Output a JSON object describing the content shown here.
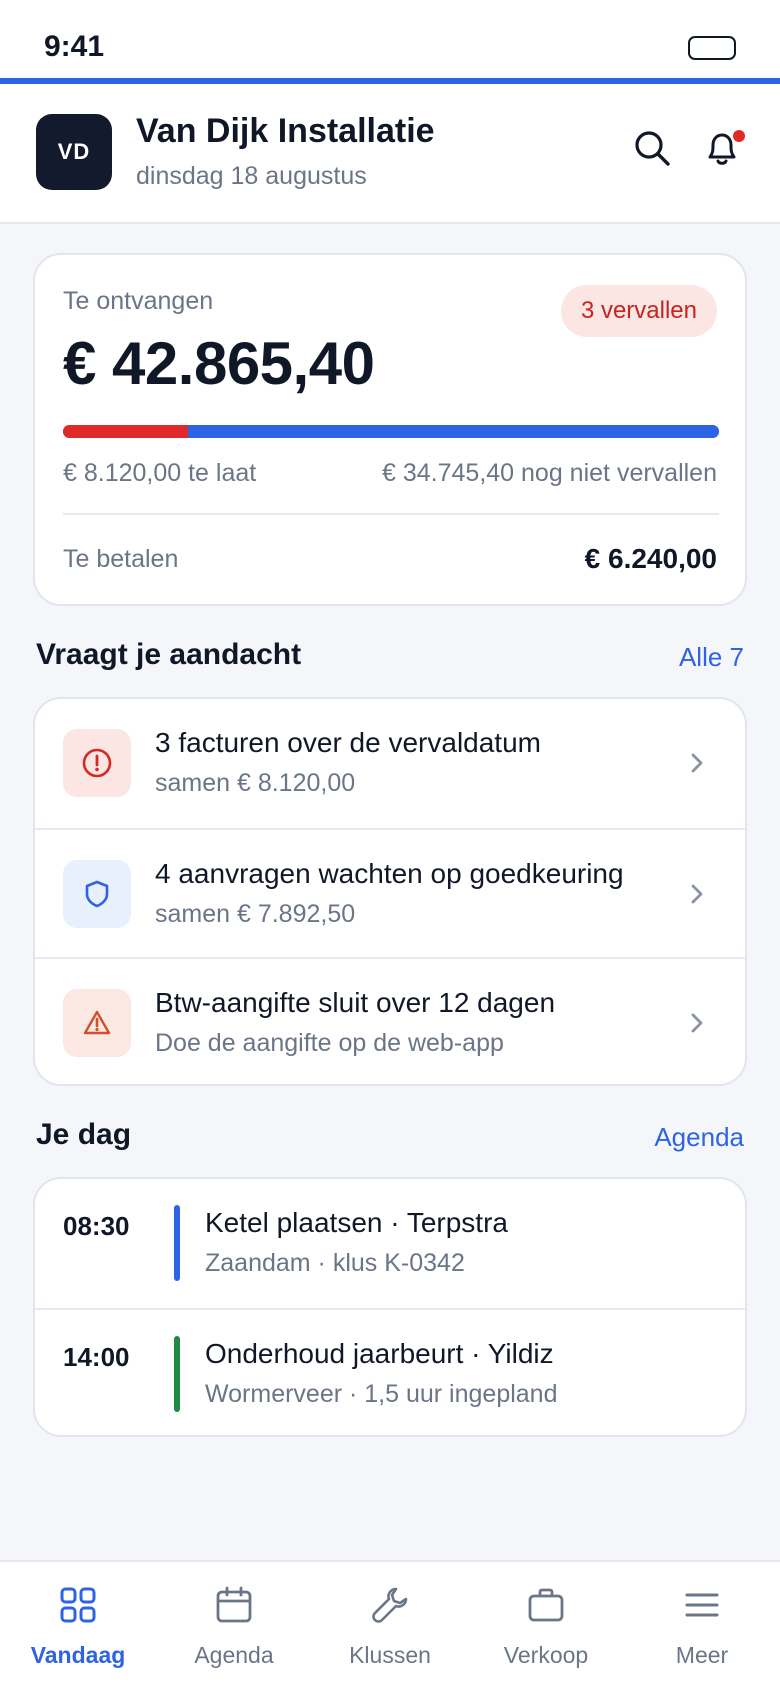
{
  "status_bar": {
    "time": "9:41"
  },
  "header": {
    "avatar_initials": "VD",
    "company": "Van Dijk Installatie",
    "date": "dinsdag 18 augustus",
    "icons": [
      "search-icon",
      "bell-icon"
    ],
    "has_notification": true
  },
  "receivable": {
    "label": "Te ontvangen",
    "badge": "3 vervallen",
    "amount": "€ 42.865,40",
    "overdue_fraction": 0.19,
    "late_text": "€ 8.120,00 te laat",
    "notdue_text": "€ 34.745,40 nog niet vervallen",
    "pay_label": "Te betalen",
    "pay_amount": "€ 6.240,00"
  },
  "attention": {
    "title": "Vraagt je aandacht",
    "link": "Alle 7",
    "items": [
      {
        "icon": "alert-circle-icon",
        "title": "3 facturen over de vervaldatum",
        "subtitle": "samen € 8.120,00"
      },
      {
        "icon": "shield-icon",
        "title": "4 aanvragen wachten op goedkeuring",
        "subtitle": "samen € 7.892,50"
      },
      {
        "icon": "warning-triangle-icon",
        "title": "Btw-aangifte sluit over 12 dagen",
        "subtitle": "Doe de aangifte op de web-app"
      }
    ]
  },
  "day": {
    "title": "Je dag",
    "link": "Agenda",
    "appointments": [
      {
        "time": "08:30",
        "title": "Ketel plaatsen · Terpstra",
        "subtitle": "Zaandam · klus K-0342",
        "color": "#2f63e6"
      },
      {
        "time": "14:00",
        "title": "Onderhoud jaarbeurt · Yildiz",
        "subtitle": "Wormerveer · 1,5 uur ingepland",
        "color": "#1f8a45"
      }
    ]
  },
  "bottom_nav": {
    "items": [
      {
        "label": "Vandaag",
        "icon": "grid-icon",
        "active": true
      },
      {
        "label": "Agenda",
        "icon": "calendar-icon",
        "active": false
      },
      {
        "label": "Klussen",
        "icon": "wrench-icon",
        "active": false
      },
      {
        "label": "Verkoop",
        "icon": "briefcase-icon",
        "active": false
      },
      {
        "label": "Meer",
        "icon": "menu-icon",
        "active": false
      }
    ]
  },
  "colors": {
    "accent": "#2f63e6",
    "danger": "#e02a2a",
    "success": "#1f8a45"
  }
}
